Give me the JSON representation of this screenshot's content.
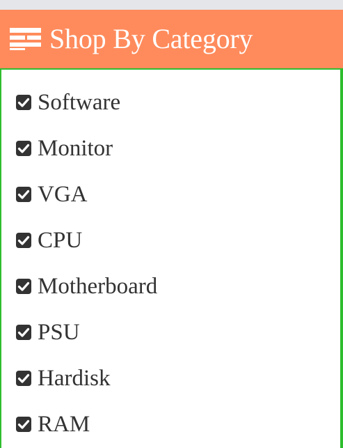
{
  "header": {
    "icon": "list-menu-icon",
    "title": "Shop By Category"
  },
  "colors": {
    "header_bg": "#ff8b5c",
    "panel_border": "#2ebd2e",
    "text": "#333333"
  },
  "categories": [
    {
      "label": "Software",
      "checked": true
    },
    {
      "label": "Monitor",
      "checked": true
    },
    {
      "label": "VGA",
      "checked": true
    },
    {
      "label": "CPU",
      "checked": true
    },
    {
      "label": "Motherboard",
      "checked": true
    },
    {
      "label": "PSU",
      "checked": true
    },
    {
      "label": "Hardisk",
      "checked": true
    },
    {
      "label": "RAM",
      "checked": true
    }
  ]
}
